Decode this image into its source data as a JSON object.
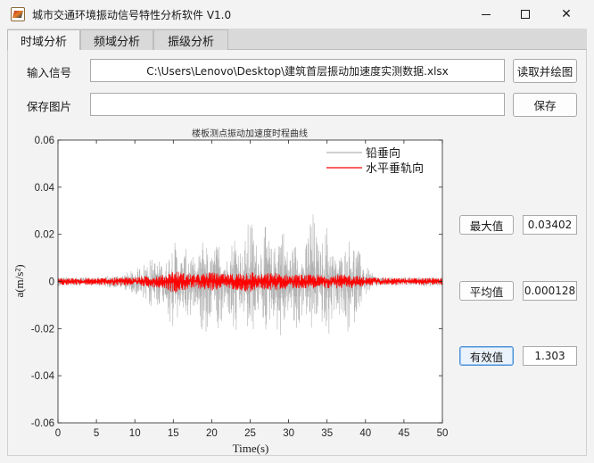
{
  "window": {
    "title": "城市交通环境振动信号特性分析软件 V1.0",
    "minimize": "minimize",
    "maximize": "maximize",
    "close": "✕"
  },
  "tabs": [
    {
      "label": "时域分析",
      "active": true
    },
    {
      "label": "频域分析",
      "active": false
    },
    {
      "label": "振级分析",
      "active": false
    }
  ],
  "input": {
    "label": "输入信号",
    "value": "C:\\Users\\Lenovo\\Desktop\\建筑首层振动加速度实测数据.xlsx",
    "button": "读取并绘图"
  },
  "save": {
    "label": "保存图片",
    "value": "",
    "button": "保存"
  },
  "stats": {
    "max_label": "最大值",
    "max_value": "0.03402",
    "mean_label": "平均值",
    "mean_value": "0.000128",
    "rms_label": "有效值",
    "rms_value": "1.303"
  },
  "chart_data": {
    "type": "line",
    "title": "楼板测点振动加速度时程曲线",
    "xlabel": "Time(s)",
    "ylabel": "a(m/s²)",
    "xlim": [
      0,
      50
    ],
    "ylim": [
      -0.06,
      0.06
    ],
    "xticks": [
      "0",
      "5",
      "10",
      "15",
      "20",
      "25",
      "30",
      "35",
      "40",
      "45",
      "50"
    ],
    "yticks": [
      "0.06",
      "0.04",
      "0.02",
      "0",
      "-0.02",
      "-0.04",
      "-0.06"
    ],
    "grid": false,
    "legend_position": "top-right",
    "series": [
      {
        "name": "铅垂向",
        "color": "#b3b3b3",
        "envelope_x": [
          0,
          5,
          8,
          10,
          12,
          14,
          15,
          16,
          17,
          18,
          19,
          20,
          21,
          22,
          23,
          24,
          25,
          26,
          27,
          28,
          29,
          30,
          31,
          32,
          33,
          34,
          35,
          36,
          37,
          38,
          39,
          40,
          41,
          42,
          45,
          50
        ],
        "envelope_pos": [
          0.002,
          0.002,
          0.003,
          0.005,
          0.01,
          0.008,
          0.019,
          0.01,
          0.016,
          0.006,
          0.022,
          0.012,
          0.018,
          0.01,
          0.023,
          0.012,
          0.03,
          0.014,
          0.024,
          0.012,
          0.03,
          0.011,
          0.018,
          0.01,
          0.034,
          0.013,
          0.025,
          0.01,
          0.012,
          0.02,
          0.014,
          0.007,
          0.003,
          0.002,
          0.002,
          0.002
        ],
        "envelope_neg": [
          -0.002,
          -0.002,
          -0.003,
          -0.005,
          -0.012,
          -0.009,
          -0.026,
          -0.011,
          -0.018,
          -0.008,
          -0.028,
          -0.013,
          -0.026,
          -0.011,
          -0.028,
          -0.013,
          -0.028,
          -0.013,
          -0.022,
          -0.015,
          -0.027,
          -0.012,
          -0.026,
          -0.011,
          -0.025,
          -0.012,
          -0.03,
          -0.011,
          -0.019,
          -0.025,
          -0.012,
          -0.006,
          -0.003,
          -0.002,
          -0.002,
          -0.002
        ]
      },
      {
        "name": "水平垂轨向",
        "color": "#ff0000",
        "envelope_x": [
          0,
          5,
          10,
          14,
          15,
          16,
          18,
          20,
          22,
          24,
          25,
          26,
          28,
          30,
          32,
          34,
          36,
          38,
          40,
          42,
          45,
          50
        ],
        "envelope_pos": [
          0.0015,
          0.0015,
          0.002,
          0.003,
          0.005,
          0.004,
          0.003,
          0.004,
          0.003,
          0.004,
          0.005,
          0.003,
          0.004,
          0.003,
          0.003,
          0.003,
          0.003,
          0.003,
          0.002,
          0.0015,
          0.0015,
          0.0015
        ],
        "envelope_neg": [
          -0.0015,
          -0.0015,
          -0.002,
          -0.003,
          -0.005,
          -0.004,
          -0.003,
          -0.004,
          -0.003,
          -0.004,
          -0.005,
          -0.003,
          -0.004,
          -0.003,
          -0.003,
          -0.003,
          -0.003,
          -0.003,
          -0.002,
          -0.0015,
          -0.0015,
          -0.0015
        ]
      }
    ]
  }
}
